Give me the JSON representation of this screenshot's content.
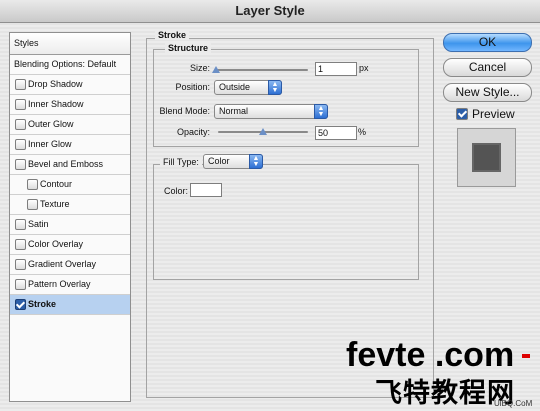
{
  "window": {
    "title": "Layer Style"
  },
  "sidebar": {
    "header": "Styles",
    "items": [
      {
        "label": "Blending Options: Default",
        "checkbox": false,
        "checked": false,
        "sub": false,
        "active": false
      },
      {
        "label": "Drop Shadow",
        "checkbox": true,
        "checked": false,
        "sub": false,
        "active": false
      },
      {
        "label": "Inner Shadow",
        "checkbox": true,
        "checked": false,
        "sub": false,
        "active": false
      },
      {
        "label": "Outer Glow",
        "checkbox": true,
        "checked": false,
        "sub": false,
        "active": false
      },
      {
        "label": "Inner Glow",
        "checkbox": true,
        "checked": false,
        "sub": false,
        "active": false
      },
      {
        "label": "Bevel and Emboss",
        "checkbox": true,
        "checked": false,
        "sub": false,
        "active": false
      },
      {
        "label": "Contour",
        "checkbox": true,
        "checked": false,
        "sub": true,
        "active": false
      },
      {
        "label": "Texture",
        "checkbox": true,
        "checked": false,
        "sub": true,
        "active": false
      },
      {
        "label": "Satin",
        "checkbox": true,
        "checked": false,
        "sub": false,
        "active": false
      },
      {
        "label": "Color Overlay",
        "checkbox": true,
        "checked": false,
        "sub": false,
        "active": false
      },
      {
        "label": "Gradient Overlay",
        "checkbox": true,
        "checked": false,
        "sub": false,
        "active": false
      },
      {
        "label": "Pattern Overlay",
        "checkbox": true,
        "checked": false,
        "sub": false,
        "active": false
      },
      {
        "label": "Stroke",
        "checkbox": true,
        "checked": true,
        "sub": false,
        "active": true
      }
    ]
  },
  "stroke": {
    "title": "Stroke",
    "structure": {
      "title": "Structure",
      "size_label": "Size:",
      "size_value": "1",
      "size_unit": "px",
      "position_label": "Position:",
      "position_value": "Outside",
      "blend_label": "Blend Mode:",
      "blend_value": "Normal",
      "opacity_label": "Opacity:",
      "opacity_value": "50",
      "opacity_unit": "%"
    },
    "fill": {
      "label": "Fill Type:",
      "value": "Color",
      "color_label": "Color:",
      "color_value": "#ffffff"
    }
  },
  "buttons": {
    "ok": "OK",
    "cancel": "Cancel",
    "new_style": "New Style..."
  },
  "preview": {
    "label": "Preview",
    "checked": true
  },
  "watermark": {
    "line1a": "fevte",
    "line1b": " .com",
    "line2": "飞特教程网",
    "line3": "UiBQ.CoM"
  },
  "colors": {
    "accent": "#3e95ec",
    "active_row": "#b7d1f0",
    "swatch_preview": "#545454"
  }
}
